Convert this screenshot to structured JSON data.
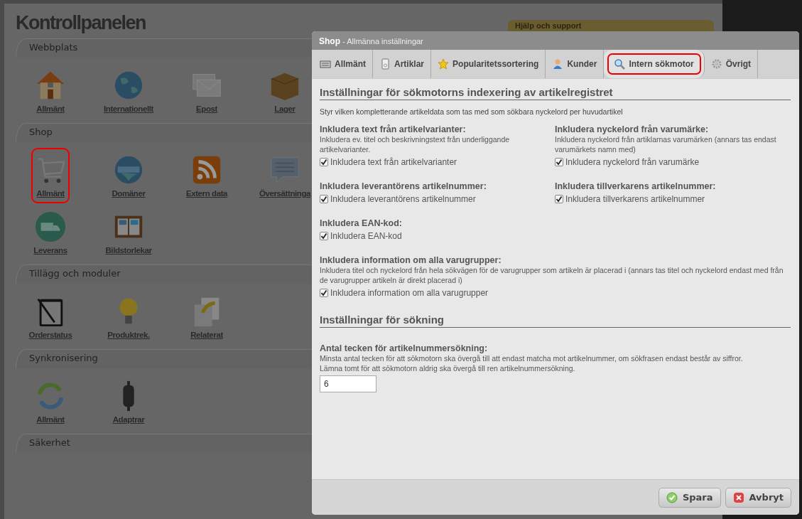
{
  "page": {
    "title": "Kontrollpanelen",
    "help_box": {
      "title": "Hjälp och support"
    },
    "groups": [
      {
        "title": "Webbplats",
        "items": [
          {
            "label": "Allmänt",
            "highlighted": false
          },
          {
            "label": "Internationellt",
            "highlighted": false
          },
          {
            "label": "Epost",
            "highlighted": false
          },
          {
            "label": "Lager",
            "highlighted": false
          }
        ]
      },
      {
        "title": "Shop",
        "items": [
          {
            "label": "Allmänt",
            "highlighted": true
          },
          {
            "label": "Domäner",
            "highlighted": false
          },
          {
            "label": "Extern data",
            "highlighted": false
          },
          {
            "label": "Översättninga",
            "highlighted": false
          },
          {
            "label": "Leverans",
            "highlighted": false
          },
          {
            "label": "Bildstorlekar",
            "highlighted": false
          }
        ]
      },
      {
        "title": "Tillägg och moduler",
        "items": [
          {
            "label": "Orderstatus",
            "highlighted": false
          },
          {
            "label": "Produktrek.",
            "highlighted": false
          },
          {
            "label": "Relaterat",
            "highlighted": false
          }
        ]
      },
      {
        "title": "Synkronisering",
        "items": [
          {
            "label": "Allmänt",
            "highlighted": false
          },
          {
            "label": "Adaptrar",
            "highlighted": false
          }
        ]
      },
      {
        "title": "Säkerhet"
      }
    ]
  },
  "dialog": {
    "title_bold": "Shop",
    "title_rest": " - Allmänna inställningar",
    "tabs": [
      {
        "label": "Allmänt",
        "selected": false
      },
      {
        "label": "Artiklar",
        "selected": false
      },
      {
        "label": "Popularitetssortering",
        "selected": false
      },
      {
        "label": "Kunder",
        "selected": false
      },
      {
        "label": "Intern sökmotor",
        "selected": true
      },
      {
        "label": "Övrigt",
        "selected": false
      }
    ],
    "sections": [
      {
        "heading": "Inställningar för sökmotorns indexering av artikelregistret",
        "description": "Styr vilken kompletterande artikeldata som tas med som sökbara nyckelord per huvudartikel",
        "rows": [
          [
            {
              "kind": "checkbox",
              "label": "Inkludera text från artikelvarianter:",
              "description": "Inkludera ev. titel och beskrivningstext från underliggande artikelvarianter.",
              "option": "Inkludera text från artikelvarianter",
              "checked": true
            },
            {
              "kind": "checkbox",
              "label": "Inkludera nyckelord från varumärke:",
              "description": "Inkludera nyckelord från artiklarnas varumärken (annars tas endast varumärkets namn med)",
              "option": "Inkludera nyckelord från varumärke",
              "checked": true
            }
          ],
          [
            {
              "kind": "checkbox",
              "label": "Inkludera leverantörens artikelnummer:",
              "option": "Inkludera leverantörens artikelnummer",
              "checked": true
            },
            {
              "kind": "checkbox",
              "label": "Inkludera tillverkarens artikelnummer:",
              "option": "Inkludera tillverkarens artikelnummer",
              "checked": true
            }
          ],
          [
            {
              "kind": "checkbox",
              "label": "Inkludera EAN-kod:",
              "option": "Inkludera EAN-kod",
              "checked": true
            }
          ],
          [
            {
              "kind": "checkbox",
              "label": "Inkludera information om alla varugrupper:",
              "description": "Inkludera titel och nyckelord från hela sökvägen för de varugrupper som artikeln är placerad i (annars tas titel och nyckelord endast med från de varugrupper artikeln är direkt placerad i)",
              "option": "Inkludera information om alla varugrupper",
              "checked": true
            }
          ]
        ]
      },
      {
        "heading": "Inställningar för sökning",
        "rows": [
          [
            {
              "kind": "text",
              "label": "Antal tecken för artikelnummersökning:",
              "description": "Minsta antal tecken för att sökmotorn ska övergå till att endast matcha mot artikelnummer, om sökfrasen endast består av siffror.\nLämna tomt för att sökmotorn aldrig ska övergå till ren artikelnummersökning.",
              "value": "6"
            }
          ]
        ]
      }
    ],
    "buttons": [
      {
        "label": "Spara",
        "kind": "save"
      },
      {
        "label": "Avbryt",
        "kind": "cancel"
      }
    ]
  }
}
